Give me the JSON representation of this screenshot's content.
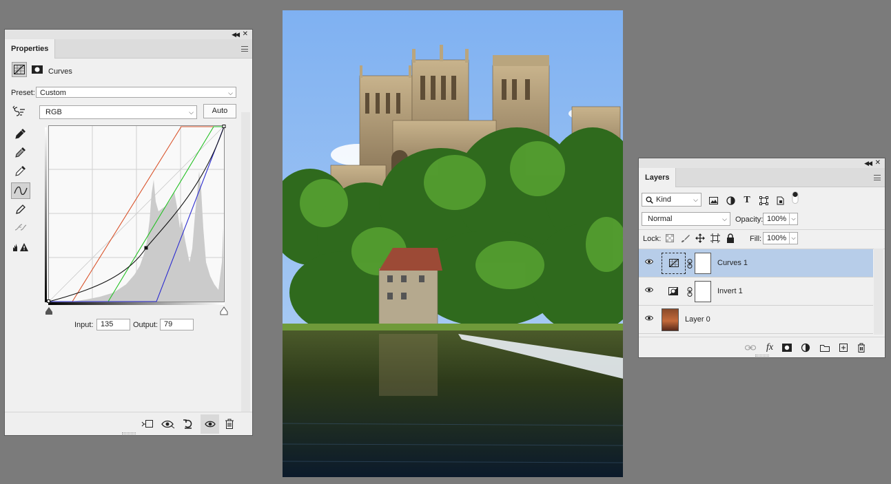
{
  "properties": {
    "tab_label": "Properties",
    "adjustment_name": "Curves",
    "preset_label": "Preset:",
    "preset_value": "Custom",
    "channel_value": "RGB",
    "auto_label": "Auto",
    "input_label": "Input:",
    "input_value": "135",
    "output_label": "Output:",
    "output_value": "79"
  },
  "layers": {
    "tab_label": "Layers",
    "filter_kind": "Kind",
    "blend_mode": "Normal",
    "opacity_label": "Opacity:",
    "opacity_value": "100%",
    "lock_label": "Lock:",
    "fill_label": "Fill:",
    "fill_value": "100%",
    "items": [
      {
        "name": "Curves 1",
        "selected": true,
        "type": "curves-adjustment"
      },
      {
        "name": "Invert 1",
        "selected": false,
        "type": "invert-adjustment"
      },
      {
        "name": "Layer 0",
        "selected": false,
        "type": "image"
      }
    ]
  },
  "colors": {
    "panel_bg": "#f0f0f0",
    "selected_row": "#b7cde9",
    "canvas_bg": "#7b7b7b",
    "curve_red": "#d9532b",
    "curve_green": "#22c022",
    "curve_blue": "#2a2ad0",
    "curve_composite": "#111111"
  }
}
